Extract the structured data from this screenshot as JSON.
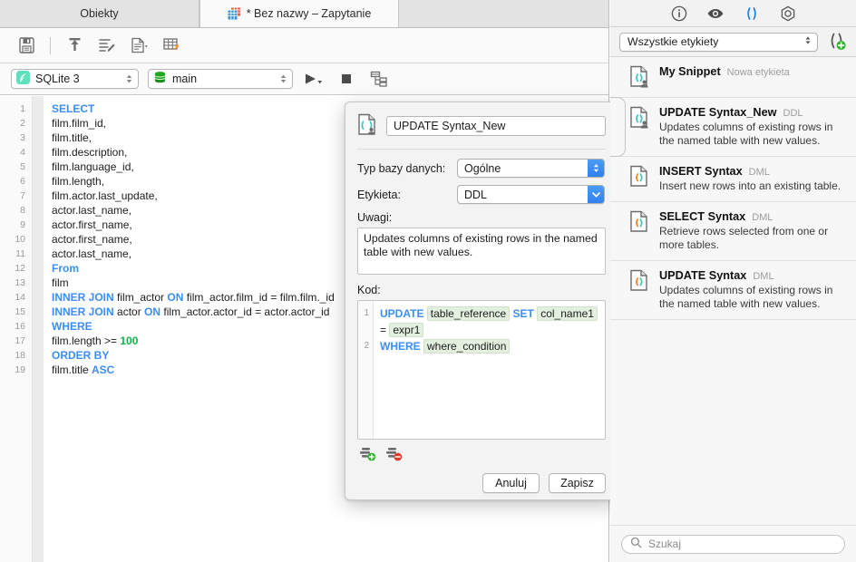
{
  "tabs": [
    {
      "label": "Obiekty",
      "icon": "",
      "active": false
    },
    {
      "label": "* Bez nazwy – Zapytanie",
      "icon": "table-icon",
      "active": true
    }
  ],
  "toolbar": {
    "icons": [
      {
        "name": "save-icon"
      },
      {
        "name": "upload-icon"
      },
      {
        "name": "format-sql-icon"
      },
      {
        "name": "document-dropdown-icon"
      },
      {
        "name": "table-export-icon"
      }
    ]
  },
  "connection_bar": {
    "driver": "SQLite 3",
    "database": "main",
    "run_icon": "play-icon",
    "stop_icon": "stop-icon",
    "plan_icon": "explain-plan-icon"
  },
  "sql_editor": {
    "line_numbers": [
      "1",
      "2",
      "3",
      "4",
      "5",
      "6",
      "7",
      "8",
      "9",
      "10",
      "11",
      "12",
      "13",
      "14",
      "15",
      "16",
      "17",
      "18",
      "19"
    ],
    "lines": [
      [
        {
          "t": "SELECT",
          "c": "kw"
        }
      ],
      [
        {
          "t": "film.film_id,",
          "c": ""
        }
      ],
      [
        {
          "t": "film.title,",
          "c": ""
        }
      ],
      [
        {
          "t": "film.description,",
          "c": ""
        }
      ],
      [
        {
          "t": "film.language_id,",
          "c": ""
        }
      ],
      [
        {
          "t": "film.length,",
          "c": ""
        }
      ],
      [
        {
          "t": "film.actor.last_update,",
          "c": ""
        }
      ],
      [
        {
          "t": "actor.last_name,",
          "c": ""
        }
      ],
      [
        {
          "t": "actor.first_name,",
          "c": ""
        }
      ],
      [
        {
          "t": "actor.first_name,",
          "c": ""
        }
      ],
      [
        {
          "t": "actor.last_name,",
          "c": ""
        }
      ],
      [
        {
          "t": "From",
          "c": "kw"
        }
      ],
      [
        {
          "t": "film",
          "c": ""
        }
      ],
      [
        {
          "t": "INNER JOIN",
          "c": "kw"
        },
        {
          "t": " film_actor ",
          "c": ""
        },
        {
          "t": "ON",
          "c": "kw"
        },
        {
          "t": " film_actor.film_id = film.film._id",
          "c": ""
        }
      ],
      [
        {
          "t": "INNER JOIN",
          "c": "kw"
        },
        {
          "t": " actor ",
          "c": ""
        },
        {
          "t": "ON",
          "c": "kw"
        },
        {
          "t": " film_actor.actor_id = actor.actor_id",
          "c": ""
        }
      ],
      [
        {
          "t": "WHERE",
          "c": "kw"
        }
      ],
      [
        {
          "t": "film.length >= ",
          "c": ""
        },
        {
          "t": "100",
          "c": "num"
        }
      ],
      [
        {
          "t": "ORDER BY",
          "c": "kw"
        }
      ],
      [
        {
          "t": "film.title ",
          "c": ""
        },
        {
          "t": "ASC",
          "c": "kw"
        }
      ]
    ]
  },
  "dialog": {
    "icon": "snippet-icon",
    "name_value": "UPDATE Syntax_New",
    "db_type_label": "Typ bazy danych:",
    "db_type_value": "Ogólne",
    "label_label": "Etykieta:",
    "label_value": "DDL",
    "notes_label": "Uwagi:",
    "notes_value": "Updates columns of existing rows in the named table with new values.",
    "code_label": "Kod:",
    "code_line_numbers": [
      "1",
      "2"
    ],
    "code_lines": [
      [
        {
          "t": "UPDATE",
          "c": "kw"
        },
        {
          "t": " ",
          "c": ""
        },
        {
          "t": "table_reference",
          "c": "tok"
        },
        {
          "t": " ",
          "c": ""
        },
        {
          "t": "SET",
          "c": "kw"
        },
        {
          "t": " ",
          "c": ""
        },
        {
          "t": "col_name1",
          "c": "tok"
        }
      ],
      [
        {
          "t": "= ",
          "c": ""
        },
        {
          "t": "expr1",
          "c": "tok"
        }
      ],
      [
        {
          "t": "WHERE",
          "c": "kw"
        },
        {
          "t": " ",
          "c": ""
        },
        {
          "t": "where_condition",
          "c": "tok"
        }
      ]
    ],
    "add_row_icon": "add-row-icon",
    "remove_row_icon": "remove-row-icon",
    "cancel_label": "Anuluj",
    "save_label": "Zapisz"
  },
  "sidebar": {
    "icon_bar": [
      {
        "name": "info-icon",
        "active": false
      },
      {
        "name": "eye-icon",
        "active": false
      },
      {
        "name": "snippets-parens-icon",
        "active": true
      },
      {
        "name": "hex-settings-icon",
        "active": false
      }
    ],
    "filter_value": "Wszystkie etykiety",
    "add_snippet_icon": "add-snippet-icon",
    "snippets": [
      {
        "title": "My Snippet",
        "tag": "Nowa etykieta",
        "desc": "",
        "icon": "snippet-ddl-icon",
        "selected": false
      },
      {
        "title": "UPDATE Syntax_New",
        "tag": "DDL",
        "desc": "Updates columns of existing rows in the named table with new values.",
        "icon": "snippet-ddl-icon",
        "selected": true
      },
      {
        "title": "INSERT Syntax",
        "tag": "DML",
        "desc": "Insert new rows into an existing table.",
        "icon": "snippet-dml-icon",
        "selected": false
      },
      {
        "title": "SELECT Syntax",
        "tag": "DML",
        "desc": "Retrieve rows selected from one or more tables.",
        "icon": "snippet-dml-icon",
        "selected": false
      },
      {
        "title": "UPDATE Syntax",
        "tag": "DML",
        "desc": "Updates columns of existing rows in the named table with new values.",
        "icon": "snippet-dml-icon",
        "selected": false
      }
    ],
    "search_placeholder": "Szukaj",
    "search_icon": "search-icon"
  },
  "colors": {
    "keyword": "#3a8ef6",
    "number": "#11b149",
    "token_bg": "#e3f0df",
    "accent_blue": "#2f81ef",
    "teal": "#3fc4c0",
    "orange": "#f0821e"
  }
}
